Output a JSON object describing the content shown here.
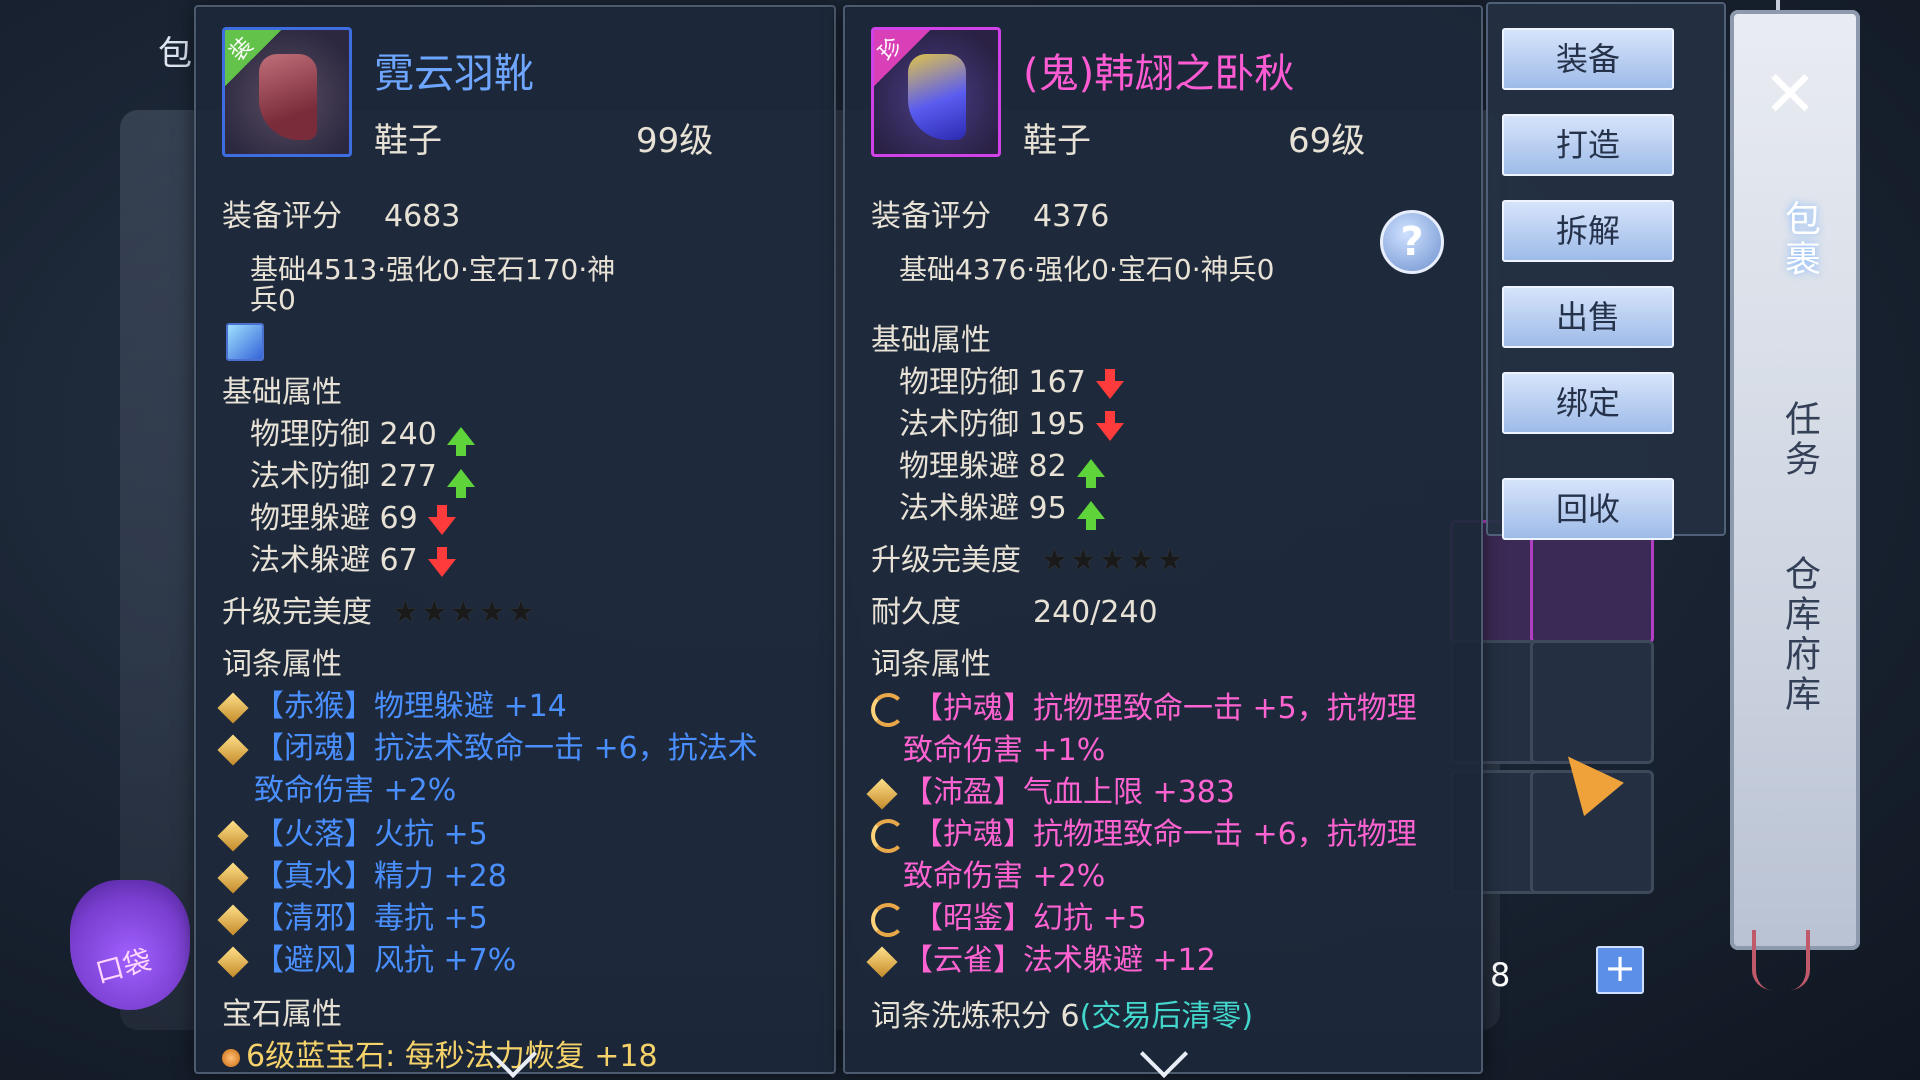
{
  "window": {
    "close_symbol": "✕",
    "corner_label": "包"
  },
  "side_tabs": [
    {
      "label": "包裹",
      "active": true
    },
    {
      "label": "任务",
      "active": false
    },
    {
      "label": "仓库府库",
      "active": false
    }
  ],
  "left_item": {
    "corner_tag": "装",
    "name": "霓云羽靴",
    "type": "鞋子",
    "level": "99级",
    "score_label": "装备评分",
    "score_value": "4683",
    "score_breakdown": "基础4513·强化0·宝石170·神兵0",
    "base_attr_title": "基础属性",
    "base_attrs": [
      {
        "text": "物理防御 240",
        "trend": "up"
      },
      {
        "text": "法术防御 277",
        "trend": "up"
      },
      {
        "text": "物理躲避 69",
        "trend": "down"
      },
      {
        "text": "法术躲避 67",
        "trend": "down"
      }
    ],
    "upgrade_label": "升级完美度",
    "stars": "★★★★★",
    "affix_title": "词条属性",
    "affixes": [
      "【赤猴】物理躲避 +14",
      "【闭魂】抗法术致命一击 +6，抗法术",
      "致命伤害 +2%",
      "【火落】火抗 +5",
      "【真水】精力 +28",
      "【清邪】毒抗 +5",
      "【避风】风抗 +7%"
    ],
    "gem_title": "宝石属性",
    "gem_text": "6级蓝宝石: 每秒法力恢复 +18"
  },
  "right_item": {
    "corner_tag": "珍",
    "name": "(鬼)韩翃之卧秋",
    "type": "鞋子",
    "level": "69级",
    "score_label": "装备评分",
    "score_value": "4376",
    "score_breakdown": "基础4376·强化0·宝石0·神兵0",
    "base_attr_title": "基础属性",
    "base_attrs": [
      {
        "text": "物理防御 167",
        "trend": "down"
      },
      {
        "text": "法术防御 195",
        "trend": "down"
      },
      {
        "text": "物理躲避 82",
        "trend": "up"
      },
      {
        "text": "法术躲避 95",
        "trend": "up"
      }
    ],
    "upgrade_label": "升级完美度",
    "stars": "★★★★★",
    "durability_label": "耐久度",
    "durability_value": "240/240",
    "affix_title": "词条属性",
    "affixes": [
      "【护魂】抗物理致命一击 +5，抗物理",
      "致命伤害 +1%",
      "【沛盈】气血上限 +383",
      "【护魂】抗物理致命一击 +6，抗物理",
      "致命伤害 +2%",
      "【昭鉴】幻抗 +5",
      "【云雀】法术躲避 +12"
    ],
    "refine_label": "词条洗炼积分 6",
    "refine_note": "(交易后清零)",
    "help_symbol": "?"
  },
  "actions": [
    "装备",
    "打造",
    "拆解",
    "出售",
    "绑定",
    "回收"
  ],
  "quantity": {
    "value": "8",
    "plus": "+"
  },
  "bag_button_label": "口袋",
  "colors": {
    "blue_quality": "#4a8fff",
    "pink_quality": "#ff63d2",
    "up": "#5fd43a",
    "down": "#ff3b3b"
  }
}
